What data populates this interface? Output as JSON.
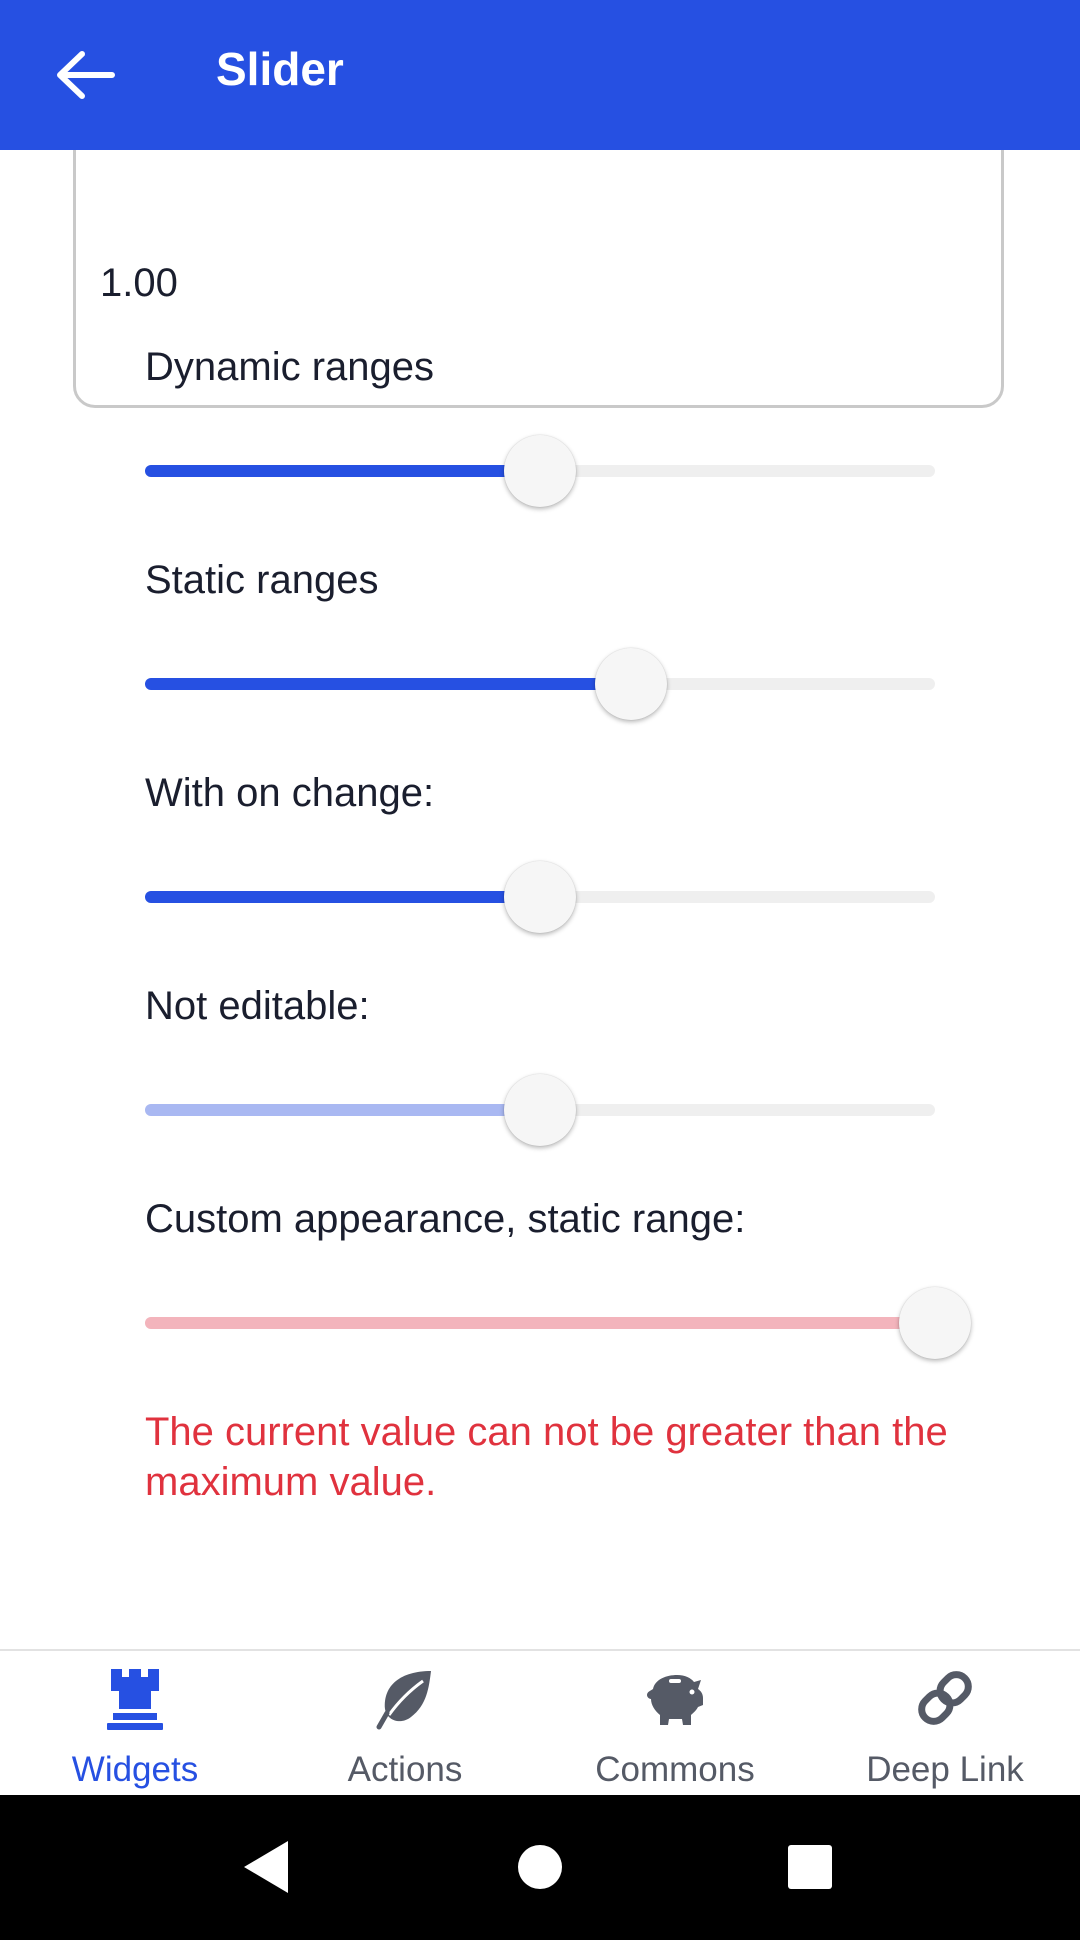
{
  "app_bar": {
    "title": "Slider",
    "back_icon": "arrow-left-icon"
  },
  "text_field": {
    "value": "1.00"
  },
  "sliders": [
    {
      "label": "Dynamic ranges",
      "value_fraction": 0.5,
      "fill_color": "#2650e2"
    },
    {
      "label": "Static ranges",
      "value_fraction": 0.615,
      "fill_color": "#2650e2"
    },
    {
      "label": "With on change:",
      "value_fraction": 0.5,
      "fill_color": "#2650e2"
    },
    {
      "label": "Not editable:",
      "value_fraction": 0.5,
      "fill_color": "#a9b8f2"
    },
    {
      "label": "Custom appearance, static range:",
      "value_fraction": 1.0,
      "fill_color": "#f3b4bc"
    }
  ],
  "error_message": "The current value can not be greater than the maximum value.",
  "bottom_nav": {
    "items": [
      {
        "label": "Widgets",
        "icon": "rook-icon",
        "active": true
      },
      {
        "label": "Actions",
        "icon": "leaf-icon",
        "active": false
      },
      {
        "label": "Commons",
        "icon": "piggy-bank-icon",
        "active": false
      },
      {
        "label": "Deep Link",
        "icon": "link-icon",
        "active": false
      }
    ],
    "active_color": "#2650e2",
    "inactive_color": "#555a66"
  },
  "colors": {
    "primary": "#2650e2",
    "error": "#e0323e"
  }
}
